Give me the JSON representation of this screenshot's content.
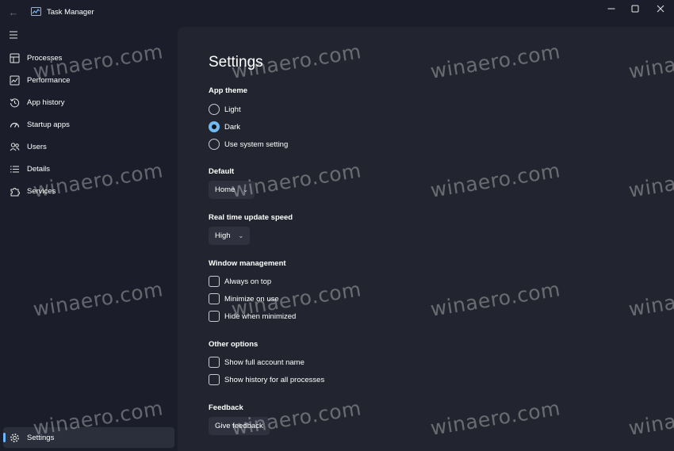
{
  "window": {
    "title": "Task Manager",
    "back_icon": "back-arrow-icon",
    "controls": [
      "minimize-icon",
      "maximize-icon",
      "close-icon"
    ]
  },
  "sidebar": {
    "menu_icon": "hamburger-icon",
    "items": [
      {
        "label": "Processes",
        "icon": "processes-icon"
      },
      {
        "label": "Performance",
        "icon": "performance-icon"
      },
      {
        "label": "App history",
        "icon": "history-icon"
      },
      {
        "label": "Startup apps",
        "icon": "speedometer-icon"
      },
      {
        "label": "Users",
        "icon": "users-icon"
      },
      {
        "label": "Details",
        "icon": "list-icon"
      },
      {
        "label": "Services",
        "icon": "puzzle-icon"
      }
    ],
    "settings": {
      "label": "Settings",
      "icon": "gear-icon",
      "selected": true
    }
  },
  "settings": {
    "title": "Settings",
    "app_theme": {
      "heading": "App theme",
      "options": [
        "Light",
        "Dark",
        "Use system setting"
      ],
      "selected": "Dark"
    },
    "default_page": {
      "heading": "Default",
      "value": "Home"
    },
    "update_speed": {
      "heading": "Real time update speed",
      "value": "High"
    },
    "window_management": {
      "heading": "Window management",
      "options": [
        {
          "label": "Always on top",
          "checked": false
        },
        {
          "label": "Minimize on use",
          "checked": false
        },
        {
          "label": "Hide when minimized",
          "checked": false
        }
      ]
    },
    "other_options": {
      "heading": "Other options",
      "options": [
        {
          "label": "Show full account name",
          "checked": false
        },
        {
          "label": "Show history for all processes",
          "checked": false
        }
      ]
    },
    "feedback": {
      "heading": "Feedback",
      "button_label": "Give feedback"
    }
  },
  "watermark": {
    "text": "winaero.com"
  },
  "colors": {
    "accent": "#74b8f2",
    "background": "#1b1e2a",
    "panel": "#22252f"
  }
}
